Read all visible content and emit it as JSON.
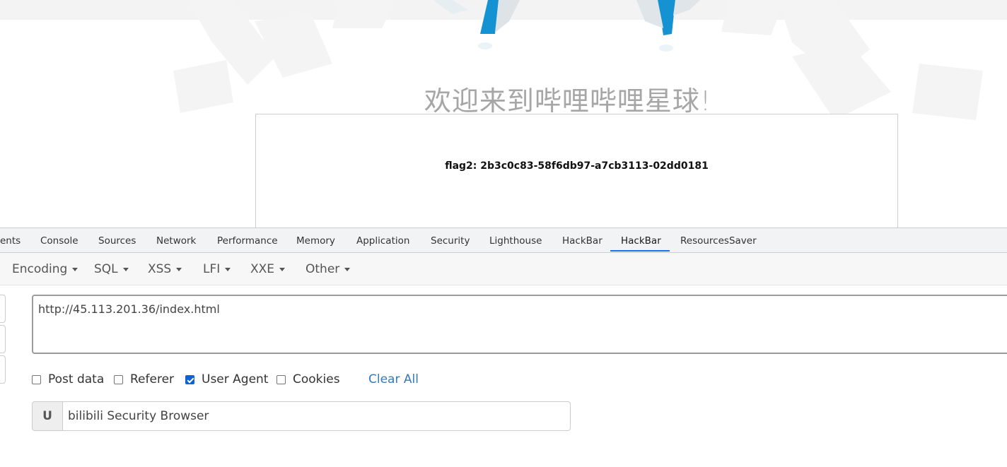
{
  "page": {
    "welcome": "欢迎来到哔哩哔哩星球!",
    "flag": "flag2: 2b3c0c83-58f6db97-a7cb3113-02dd0181"
  },
  "devtools": {
    "tabs": [
      "ents",
      "Console",
      "Sources",
      "Network",
      "Performance",
      "Memory",
      "Application",
      "Security",
      "Lighthouse",
      "HackBar",
      "HackBar",
      "ResourcesSaver"
    ],
    "active_tab": "HackBar"
  },
  "hackbar": {
    "menus": [
      "Encoding",
      "SQL",
      "XSS",
      "LFI",
      "XXE",
      "Other"
    ],
    "url": "http://45.113.201.36/index.html",
    "options": [
      {
        "label": "Post data",
        "checked": false
      },
      {
        "label": "Referer",
        "checked": false
      },
      {
        "label": "User Agent",
        "checked": true
      },
      {
        "label": "Cookies",
        "checked": false
      }
    ],
    "clear_all": "Clear All",
    "user_agent_addon": "U",
    "user_agent_value": "bilibili Security Browser"
  },
  "colors": {
    "accent": "#1a73e8",
    "link": "#337ab7",
    "checkbox_checked": "#0b63d8",
    "decoration_blue": "#1592d2"
  }
}
